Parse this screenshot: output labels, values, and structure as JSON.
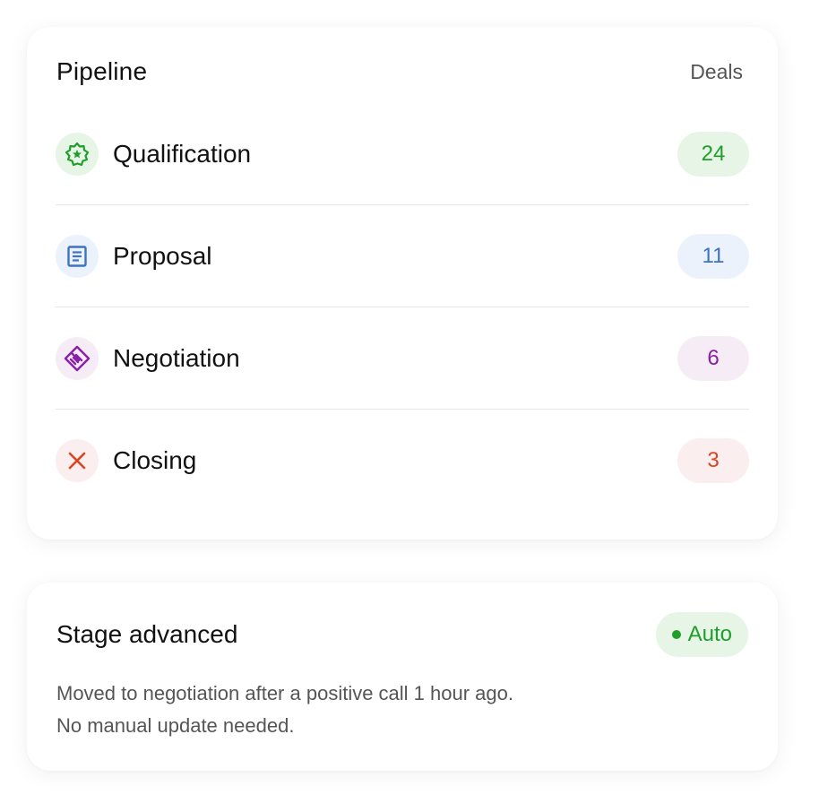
{
  "pipeline": {
    "title": "Pipeline",
    "subtitle": "Deals",
    "stages": [
      {
        "label": "Qualification",
        "count": "24",
        "icon": "badge-star-icon",
        "color": "#1f9e2c",
        "bg": "#e6f5e6"
      },
      {
        "label": "Proposal",
        "count": "11",
        "icon": "document-icon",
        "color": "#3d72c4",
        "bg": "#ebf2fb"
      },
      {
        "label": "Negotiation",
        "count": "6",
        "icon": "handshake-icon",
        "color": "#8a1fa6",
        "bg": "#f5ecf6"
      },
      {
        "label": "Closing",
        "count": "3",
        "icon": "close-x-icon",
        "color": "#d94524",
        "bg": "#fbeeee"
      }
    ]
  },
  "stage_card": {
    "title": "Stage advanced",
    "badge": {
      "label": "Auto",
      "color": "#1f9e2c",
      "bg": "#e6f5e6"
    },
    "description_line1": "Moved to negotiation after a positive call 1 hour ago.",
    "description_line2": "No manual update needed."
  }
}
